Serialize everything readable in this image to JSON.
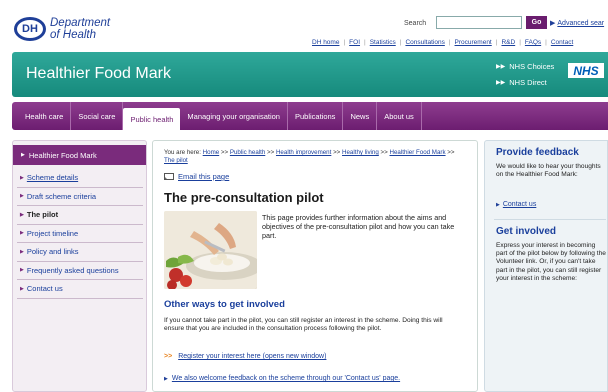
{
  "header": {
    "logo_abbr": "DH",
    "logo_line1": "Department",
    "logo_line2": "of Health",
    "search_label": "Search",
    "search_placeholder": "",
    "go_label": "Go",
    "advanced_search": "Advanced sear",
    "utility_links": [
      "DH home",
      "FOI",
      "Statistics",
      "Consultations",
      "Procurement",
      "R&D",
      "FAQs",
      "Contact"
    ]
  },
  "banner": {
    "title": "Healthier Food Mark",
    "nhs_links": [
      "NHS Choices",
      "NHS Direct"
    ],
    "nhs_logo": "NHS"
  },
  "nav": {
    "items": [
      "Health care",
      "Social care",
      "Public health",
      "Managing your organisation",
      "Publications",
      "News",
      "About us"
    ],
    "active": "Public health"
  },
  "sidebar": {
    "heading": "Healthier Food Mark",
    "items": [
      "Scheme details",
      "Draft scheme criteria",
      "The pilot",
      "Project timeline",
      "Policy and links",
      "Frequently asked questions",
      "Contact us"
    ],
    "current": "The pilot"
  },
  "main": {
    "breadcrumb_prefix": "You are here:",
    "breadcrumb": [
      "Home",
      "Public health",
      "Health improvement",
      "Healthy living",
      "Healthier Food Mark",
      "The pilot"
    ],
    "email_link": "Email this page",
    "title": "The pre-consultation pilot",
    "intro": "This page provides further information about the aims and objectives of the pre-consultation pilot and how you can take part.",
    "subheading": "Other ways to get involved",
    "body": "If you cannot take part in the pilot, you can still register an interest in the scheme. Doing this will ensure that you are included in the consultation process following the pilot.",
    "register_link": "Register your interest here (opens new window)",
    "feedback_link": "We also welcome feedback on the scheme through our 'Contact us' page."
  },
  "right": {
    "feedback_title": "Provide feedback",
    "feedback_text": "We would like to hear your thoughts on the Healthier Food Mark:",
    "contact_link": "Contact us",
    "involved_title": "Get involved",
    "involved_text": "Express your interest in becoming part of the pilot below by following the Volunteer link. Or, if you can't take part in the pilot, you can still register your interest in the scheme:"
  },
  "colors": {
    "brand_blue": "#1f3f98",
    "banner_teal": "#168a7c",
    "nav_purple": "#6c1d70",
    "link": "#1a3f9c"
  }
}
